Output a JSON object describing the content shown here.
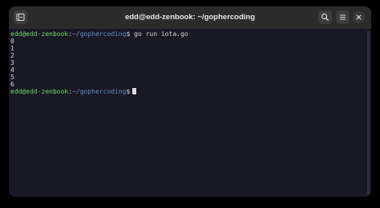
{
  "window": {
    "title": "edd@edd-zenbook: ~/gophercoding"
  },
  "icons": {
    "new_tab": "new-tab-icon",
    "search": "search-icon",
    "menu": "hamburger-menu-icon",
    "close": "close-icon"
  },
  "terminal": {
    "prompt1": {
      "user": "edd@edd-zenbook",
      "colon": ":",
      "path": "~/gophercoding",
      "dollar": "$",
      "command": " go run iota.go"
    },
    "output": [
      "0",
      "1",
      "2",
      "3",
      "4",
      "5",
      "6"
    ],
    "prompt2": {
      "user": "edd@edd-zenbook",
      "colon": ":",
      "path": "~/gophercoding",
      "dollar": "$"
    }
  },
  "colors": {
    "background": "#191825",
    "titlebar": "#2b2b2b",
    "prompt_user": "#6fd86b",
    "prompt_path": "#5f8fd6",
    "text": "#d4d4d4"
  }
}
